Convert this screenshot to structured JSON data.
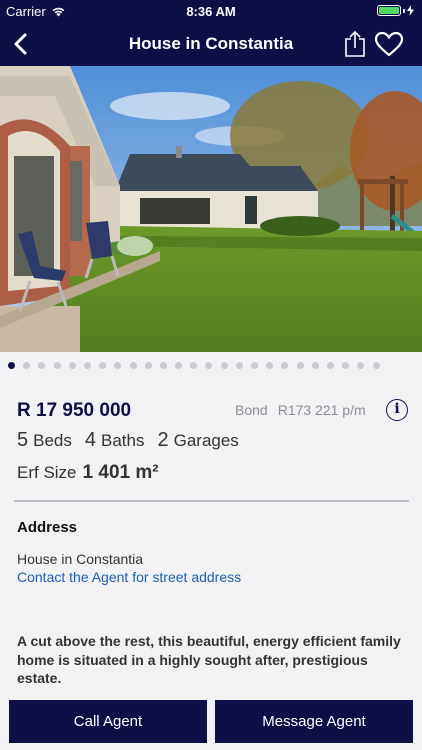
{
  "status_bar": {
    "carrier": "Carrier",
    "time": "8:36 AM",
    "battery_level": 1.0
  },
  "header": {
    "title": "House in Constantia",
    "back_icon": "chevron-left-icon",
    "share_icon": "share-icon",
    "favorite_icon": "heart-icon",
    "background": "#0f0f47"
  },
  "gallery": {
    "total_images": 25,
    "active_index": 0
  },
  "listing": {
    "price": "R 17 950 000",
    "bond_label": "Bond",
    "bond_value": "R173 221 p/m",
    "info_icon": "i",
    "features": [
      {
        "count": "5",
        "label": "Beds"
      },
      {
        "count": "4",
        "label": "Baths"
      },
      {
        "count": "2",
        "label": "Garages"
      }
    ],
    "erf_label": "Erf Size",
    "erf_value": "1 401 m²"
  },
  "address": {
    "heading": "Address",
    "line": "House in Constantia",
    "link": "Contact the Agent for street address"
  },
  "description": "A cut above the rest, this beautiful, energy efficient family home is situated in a highly sought after, prestigious estate.",
  "actions": {
    "call_label": "Call Agent",
    "message_label": "Message Agent"
  },
  "colors": {
    "brand_navy": "#0f0f47",
    "link_blue": "#1b5fae",
    "battery_green": "#4cd964"
  }
}
